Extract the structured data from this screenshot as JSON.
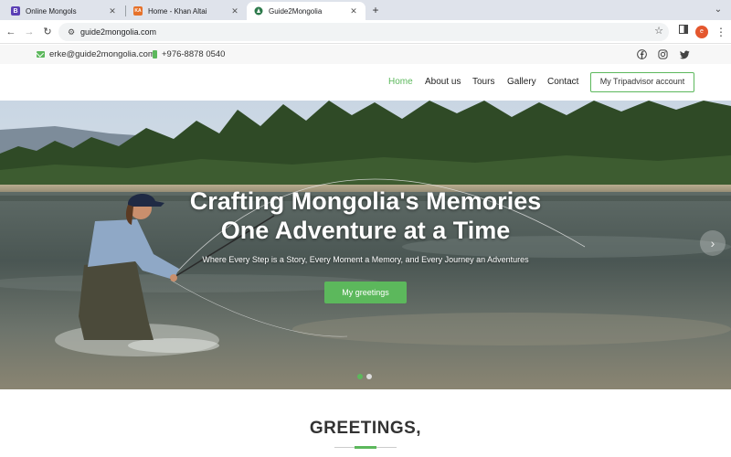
{
  "browser": {
    "tabs": [
      {
        "title": "Online Mongols",
        "favicon": "B",
        "favicon_color": "#5b3fb5",
        "active": false
      },
      {
        "title": "Home - Khan Altai",
        "favicon": "KA",
        "favicon_color": "#e6712a",
        "active": false
      },
      {
        "title": "Guide2Mongolia",
        "favicon": "",
        "favicon_color": "#2d7a4b",
        "active": true
      }
    ],
    "close_glyph": "✕",
    "new_tab_glyph": "+",
    "url": "guide2mongolia.com",
    "profile_initial": "e"
  },
  "site": {
    "accent_color": "#5cb85c",
    "email": "erke@guide2mongolia.com",
    "phone": "+976-8878 0540",
    "social": [
      "facebook-icon",
      "instagram-icon",
      "twitter-icon"
    ],
    "nav": [
      {
        "label": "Home",
        "active": true
      },
      {
        "label": "About us",
        "active": false
      },
      {
        "label": "Tours",
        "active": false
      },
      {
        "label": "Gallery",
        "active": false
      },
      {
        "label": "Contact",
        "active": false
      }
    ],
    "tripadvisor_label": "My Tripadvisor account",
    "hero": {
      "title_line1": "Crafting Mongolia's Memories",
      "title_line2": "One Adventure at a Time",
      "subtitle": "Where Every Step is a Story, Every Moment a Memory, and Every Journey an Adventures",
      "button_label": "My greetings",
      "next_glyph": "›",
      "slide_count": 2,
      "active_slide": 1
    },
    "greetings_heading": "GREETINGS,"
  }
}
